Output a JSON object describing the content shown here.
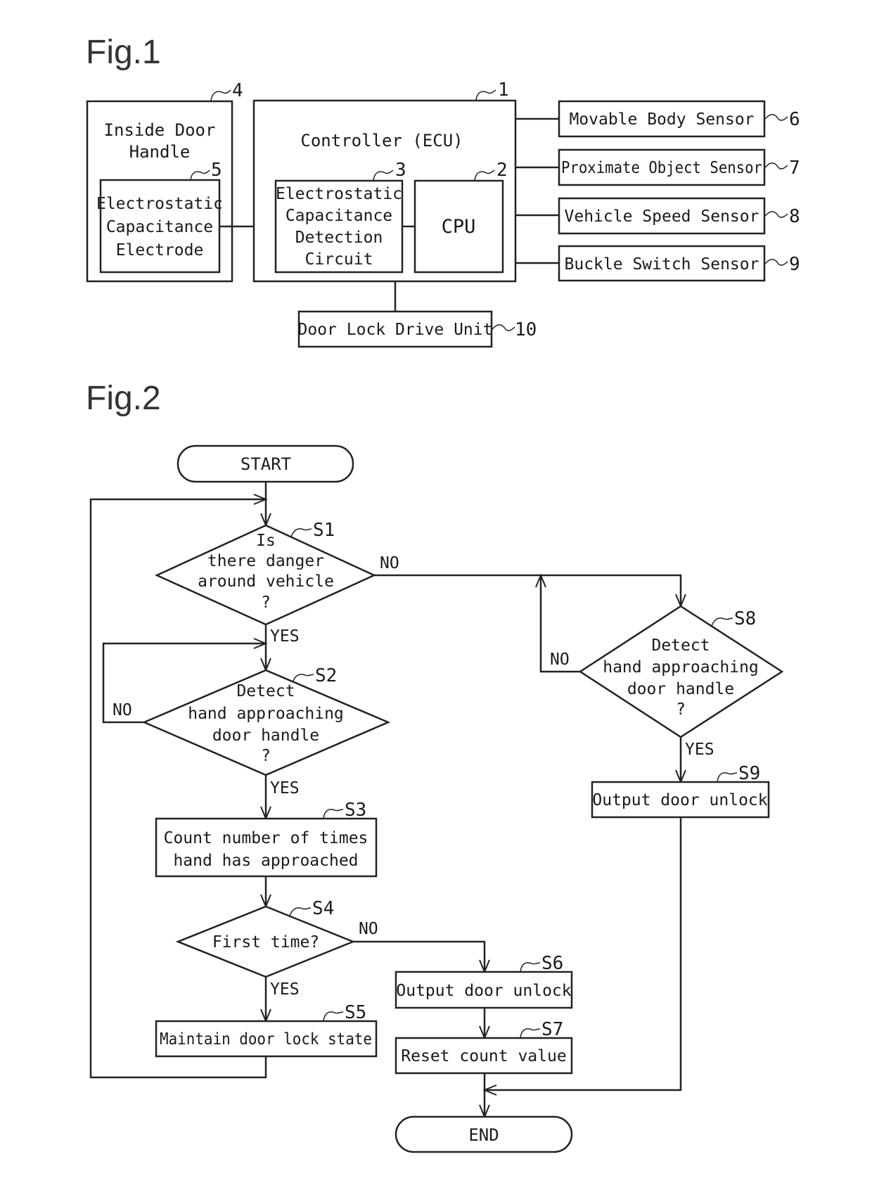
{
  "fig1": {
    "title": "Fig.1",
    "inside_door_handle": {
      "lines": [
        "Inside Door",
        "Handle"
      ],
      "ref": "4"
    },
    "electrode": {
      "lines": [
        "Electrostatic",
        "Capacitance",
        "Electrode"
      ],
      "ref": "5"
    },
    "controller": {
      "label": "Controller (ECU)",
      "ref": "1"
    },
    "detection_circuit": {
      "lines": [
        "Electrostatic",
        "Capacitance",
        "Detection",
        "Circuit"
      ],
      "ref": "3"
    },
    "cpu": {
      "label": "CPU",
      "ref": "2"
    },
    "sensors": [
      {
        "label": "Movable Body Sensor",
        "ref": "6"
      },
      {
        "label": "Proximate Object Sensor",
        "ref": "7"
      },
      {
        "label": "Vehicle Speed Sensor",
        "ref": "8"
      },
      {
        "label": "Buckle Switch Sensor",
        "ref": "9"
      }
    ],
    "door_lock_drive": {
      "label": "Door Lock Drive Unit",
      "ref": "10"
    }
  },
  "fig2": {
    "title": "Fig.2",
    "start": "START",
    "end": "END",
    "s1": {
      "lines": [
        "Is",
        "there danger",
        "around vehicle",
        "?"
      ],
      "ref": "S1"
    },
    "s2": {
      "lines": [
        "Detect",
        "hand approaching",
        "door handle",
        "?"
      ],
      "ref": "S2"
    },
    "s3": {
      "lines": [
        "Count number of times",
        "hand has approached"
      ],
      "ref": "S3"
    },
    "s4": {
      "label": "First time?",
      "ref": "S4"
    },
    "s5": {
      "label": "Maintain door lock state",
      "ref": "S5"
    },
    "s6": {
      "label": "Output door unlock",
      "ref": "S6"
    },
    "s7": {
      "label": "Reset count value",
      "ref": "S7"
    },
    "s8": {
      "lines": [
        "Detect",
        "hand approaching",
        "door handle",
        "?"
      ],
      "ref": "S8"
    },
    "s9": {
      "label": "Output door unlock",
      "ref": "S9"
    },
    "labels": {
      "s1_no": "NO",
      "s1_yes": "YES",
      "s2_no": "NO",
      "s2_yes": "YES",
      "s4_no": "NO",
      "s4_yes": "YES",
      "s8_no": "NO",
      "s8_yes": "YES"
    }
  }
}
